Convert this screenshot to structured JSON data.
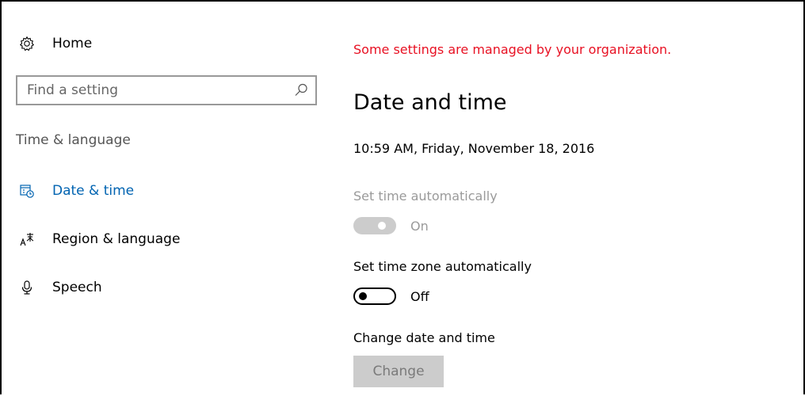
{
  "sidebar": {
    "home": {
      "label": "Home",
      "icon": "gear-icon"
    },
    "search": {
      "placeholder": "Find a setting",
      "value": "",
      "icon": "search-icon"
    },
    "section_label": "Time & language",
    "items": [
      {
        "label": "Date & time",
        "icon": "calendar-clock-icon",
        "active": true
      },
      {
        "label": "Region & language",
        "icon": "language-icon",
        "active": false
      },
      {
        "label": "Speech",
        "icon": "microphone-icon",
        "active": false
      }
    ]
  },
  "main": {
    "org_notice": "Some settings are managed by your organization.",
    "title": "Date and time",
    "current_datetime": "10:59 AM, Friday, November 18, 2016",
    "set_time_auto": {
      "label": "Set time automatically",
      "state": "On",
      "enabled": false,
      "on": true
    },
    "set_zone_auto": {
      "label": "Set time zone automatically",
      "state": "Off",
      "enabled": true,
      "on": false
    },
    "change_section": {
      "label": "Change date and time",
      "button": "Change",
      "enabled": false
    }
  },
  "colors": {
    "accent": "#0063b1",
    "warning": "#e81123",
    "disabled_text": "#9a9a9a",
    "disabled_fill": "#cccccc"
  }
}
